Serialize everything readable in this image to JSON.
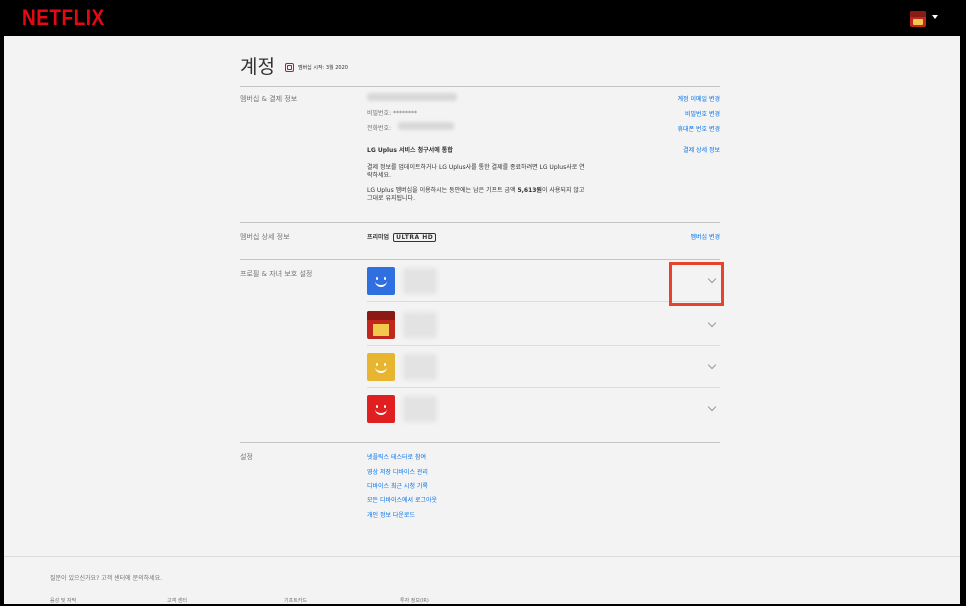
{
  "header": {
    "logo": "NETFLIX",
    "avatar_icon": "profile-avatar-icon",
    "caret_icon": "caret-down-icon"
  },
  "account": {
    "title": "계정",
    "member_since": "멤버십 시작: 3월 2020"
  },
  "billing": {
    "label": "멤버십 & 결제 정보",
    "password": "비밀번호: ********",
    "phone_label": "전화번호: ",
    "change_email": "계정 이메일 변경",
    "change_password": "비밀번호 변경",
    "change_phone": "휴대폰 번호 변경",
    "lg_heading": "LG Uplus 서비스 청구서에 통합",
    "billing_details": "결제 상세 정보",
    "lg_para1": "결제 정보를 업데이트하거나 LG Uplus사를 통한 결제를 종료하려면 LG Uplus사로 연락하세요.",
    "lg_para2_prefix": "LG Uplus 멤버십을 이용하시는 동안에는 남은 기프트 금액 ",
    "lg_para2_amount": "5,613원",
    "lg_para2_suffix": "이 사용되지 않고 그대로 유지됩니다."
  },
  "plan": {
    "label": "멤버십 상세 정보",
    "name": "프리미엄",
    "badge": "ULTRA HD",
    "change": "멤버십 변경"
  },
  "profiles": {
    "label": "프로필 & 자녀 보호 설정",
    "items": [
      {
        "color": "#2f6fe0",
        "style": "smile"
      },
      {
        "color": "#c0281e",
        "style": "grumpy"
      },
      {
        "color": "#e8b530",
        "style": "smile"
      },
      {
        "color": "#e02020",
        "style": "smile"
      }
    ]
  },
  "settings": {
    "label": "설정",
    "links": [
      "넷플릭스 테스터로 참여",
      "영상 저장 디바이스 관리",
      "디바이스 최근 시청 기록",
      "모든 디바이스에서 로그아웃",
      "개인 정보 다운로드"
    ]
  },
  "footer": {
    "question": "질문이 있으신가요? 고객 센터에 문의하세요.",
    "links": [
      "음성 및 자막",
      "고객 센터",
      "기프트카드",
      "투자 정보(IR)"
    ]
  }
}
